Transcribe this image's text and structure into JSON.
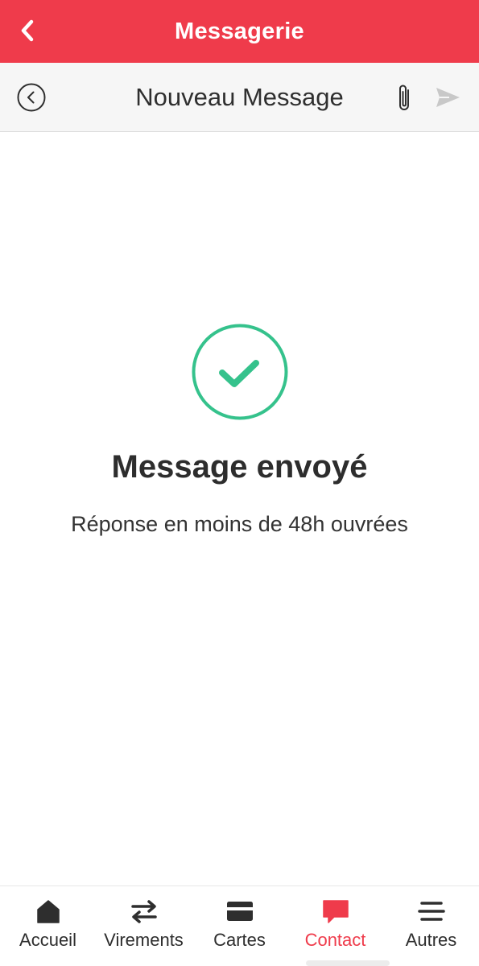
{
  "header": {
    "title": "Messagerie"
  },
  "subheader": {
    "title": "Nouveau Message"
  },
  "confirmation": {
    "title": "Message envoyé",
    "subtitle": "Réponse en moins de 48h ouvrées"
  },
  "bottom_nav": {
    "items": [
      {
        "label": "Accueil",
        "icon": "home-icon",
        "active": false
      },
      {
        "label": "Virements",
        "icon": "transfer-arrows-icon",
        "active": false
      },
      {
        "label": "Cartes",
        "icon": "card-icon",
        "active": false
      },
      {
        "label": "Contact",
        "icon": "chat-bubble-icon",
        "active": true
      },
      {
        "label": "Autres",
        "icon": "menu-lines-icon",
        "active": false
      }
    ]
  },
  "colors": {
    "brand_red": "#ef3b4b",
    "success_green": "#35c28c",
    "text_dark": "#2e2e2e",
    "subheader_bg": "#f6f6f6"
  }
}
